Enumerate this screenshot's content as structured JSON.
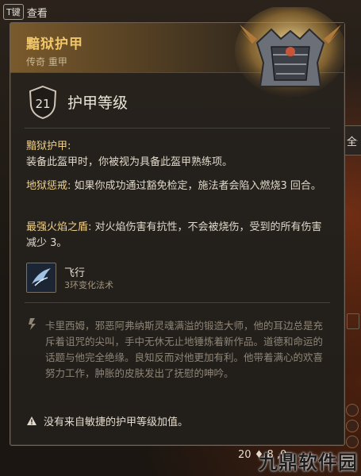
{
  "topbar": {
    "key": "T键",
    "view": "查看"
  },
  "item": {
    "name": "黯狱护甲",
    "subtitle": "传奇 重甲",
    "armor_class": "21",
    "armor_class_label": "护甲等级"
  },
  "effects": [
    {
      "title": "黯狱护甲:",
      "text": "装备此盔甲时，你被视为具备此盔甲熟练项。"
    },
    {
      "title": "地狱惩戒:",
      "text": "如果你成功通过豁免检定，施法者会陷入燃烧3 回合。"
    },
    {
      "title": "最强火焰之盾:",
      "text": "对火焰伤害有抗性，不会被烧伤，受到的所有伤害减少 3。"
    }
  ],
  "spell": {
    "name": "飞行",
    "level": "3环变化法术",
    "icon": "fly-spell-icon"
  },
  "lore": "卡里西姆，邪恶阿弗纳斯灵魂满溢的锻造大师，他的耳边总是充斥着诅咒的尖叫，手中无休无止地锤炼着新作品。道德和命运的话题与他完全绝缘。良知反而对他更加有利。他带着满心的欢喜努力工作，肿胀的皮肤发出了抚慰的呻吟。",
  "warning": "没有来自敏捷的护甲等级加值。",
  "right_edge": {
    "label": "全部"
  },
  "footer": {
    "text": "20 ♦ 8 ,0"
  },
  "watermark": "九鼎软件园",
  "colors": {
    "item_name": "#f0c66a",
    "panel_border": "#6e6356",
    "highlight": "#f0d08a"
  }
}
